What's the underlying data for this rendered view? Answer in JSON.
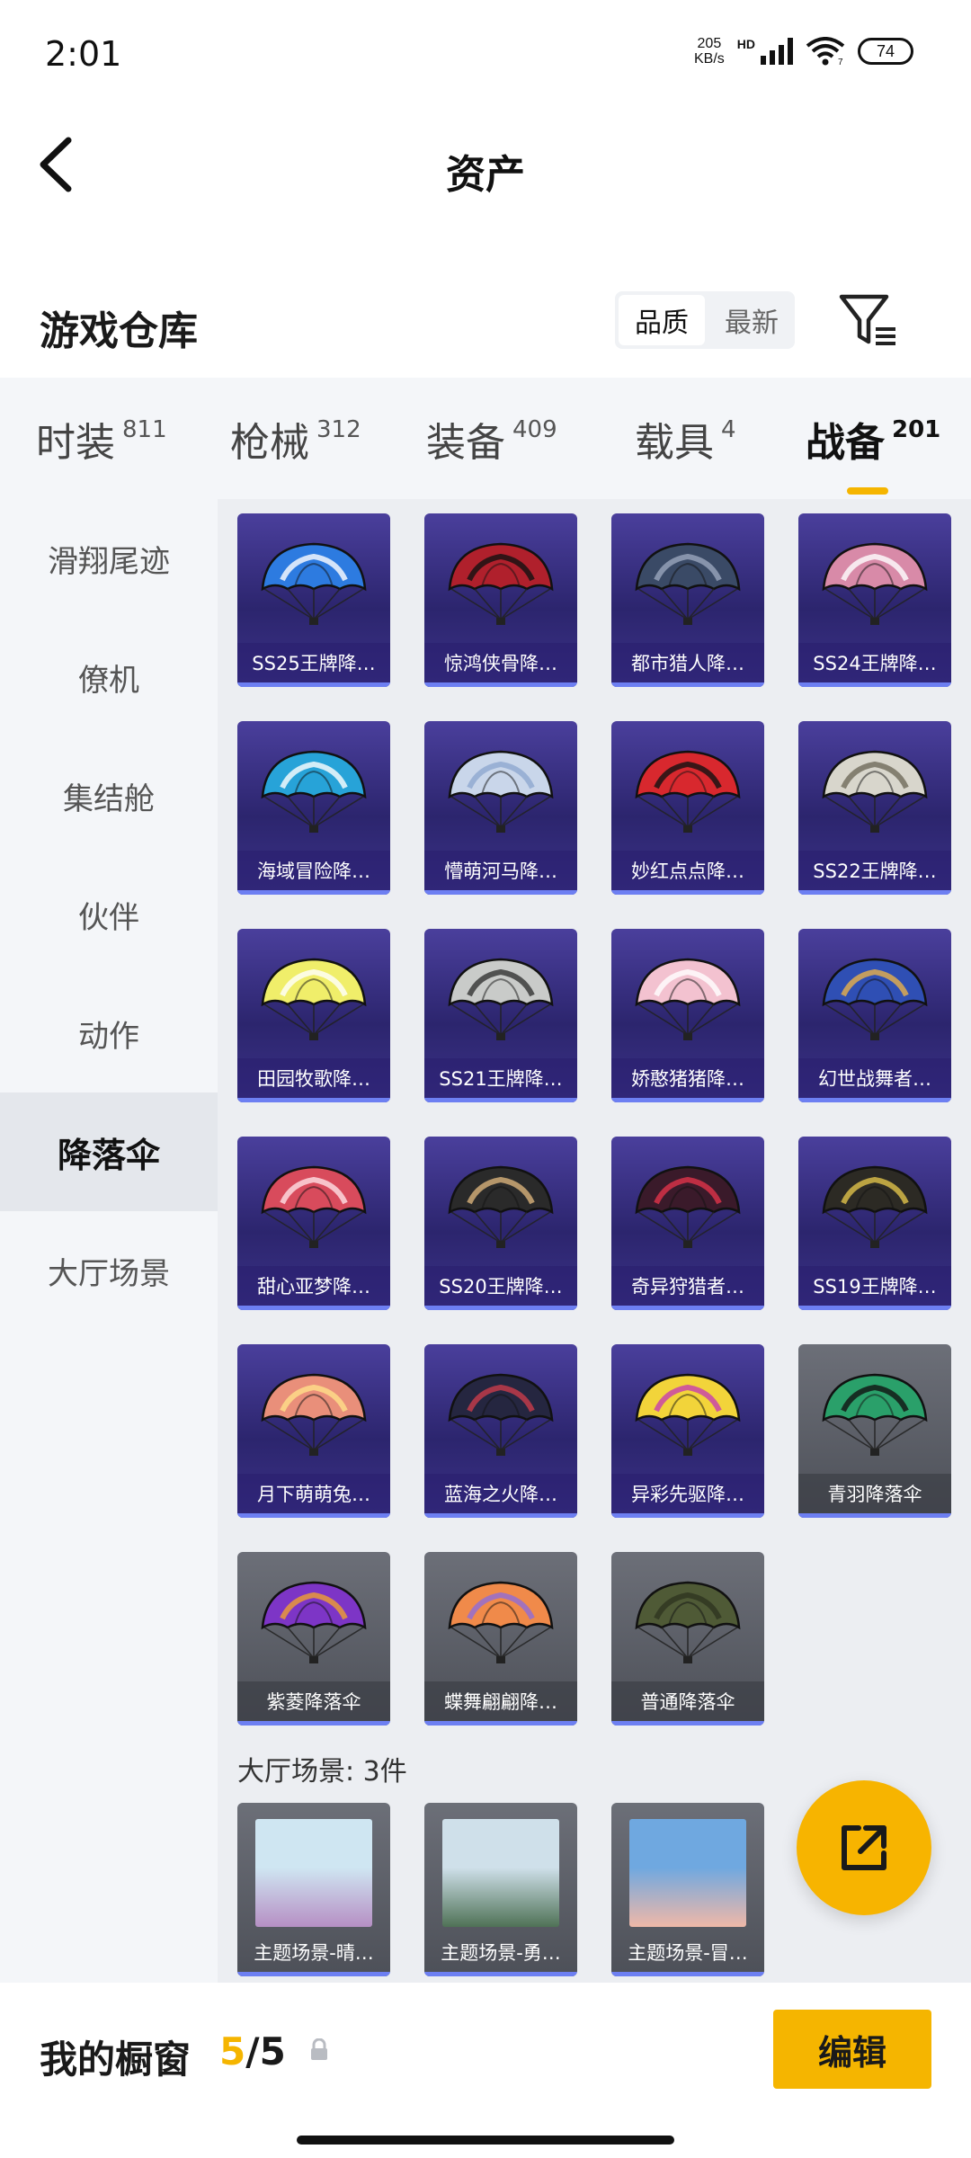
{
  "status": {
    "time": "2:01",
    "net_rate": "205",
    "net_unit": "KB/s",
    "hd": "HD",
    "wifi_sub": "7",
    "battery": "74"
  },
  "header": {
    "title": "资产",
    "back_icon": "back-chevron-icon"
  },
  "warehouse": {
    "title": "游戏仓库",
    "sort_quality": "品质",
    "sort_newest": "最新",
    "filter_icon": "filter-icon"
  },
  "tabs": [
    {
      "label": "时装",
      "count": "811",
      "active": false
    },
    {
      "label": "枪械",
      "count": "312",
      "active": false
    },
    {
      "label": "装备",
      "count": "409",
      "active": false
    },
    {
      "label": "载具",
      "count": "4",
      "active": false
    },
    {
      "label": "战备",
      "count": "201",
      "active": true
    }
  ],
  "subnav": [
    {
      "label": "滑翔尾迹",
      "active": false
    },
    {
      "label": "僚机",
      "active": false
    },
    {
      "label": "集结舱",
      "active": false
    },
    {
      "label": "伙伴",
      "active": false
    },
    {
      "label": "动作",
      "active": false
    },
    {
      "label": "降落伞",
      "active": true
    },
    {
      "label": "大厅场景",
      "active": false
    }
  ],
  "items": [
    {
      "name": "SS25王牌降…",
      "rarity": "legendary",
      "color": "#2d7be0",
      "accent": "#ffffff"
    },
    {
      "name": "惊鸿侠骨降…",
      "rarity": "legendary",
      "color": "#b0202c",
      "accent": "#111111"
    },
    {
      "name": "都市猎人降…",
      "rarity": "legendary",
      "color": "#3a4a66",
      "accent": "#9aa5bd"
    },
    {
      "name": "SS24王牌降…",
      "rarity": "legendary",
      "color": "#d88aa8",
      "accent": "#ffffff"
    },
    {
      "name": "海域冒险降…",
      "rarity": "legendary",
      "color": "#27a3d8",
      "accent": "#ffffff"
    },
    {
      "name": "懵萌河马降…",
      "rarity": "legendary",
      "color": "#c9d6ea",
      "accent": "#8fa7cf"
    },
    {
      "name": "妙红点点降…",
      "rarity": "legendary",
      "color": "#d8282e",
      "accent": "#111111"
    },
    {
      "name": "SS22王牌降…",
      "rarity": "legendary",
      "color": "#d8d6cc",
      "accent": "#6f6a5a"
    },
    {
      "name": "田园牧歌降…",
      "rarity": "legendary",
      "color": "#f0ee6a",
      "accent": "#ffffff"
    },
    {
      "name": "SS21王牌降…",
      "rarity": "legendary",
      "color": "#c9cbc9",
      "accent": "#333333"
    },
    {
      "name": "娇憨猪猪降…",
      "rarity": "legendary",
      "color": "#f3c2d0",
      "accent": "#ffffff"
    },
    {
      "name": "幻世战舞者…",
      "rarity": "legendary",
      "color": "#2f4fb4",
      "accent": "#e8b04a"
    },
    {
      "name": "甜心亚梦降…",
      "rarity": "legendary",
      "color": "#d84b5c",
      "accent": "#ffe1e6"
    },
    {
      "name": "SS20王牌降…",
      "rarity": "legendary",
      "color": "#2a2a2a",
      "accent": "#d8b27a"
    },
    {
      "name": "奇异狩猎者…",
      "rarity": "legendary",
      "color": "#3a1a2a",
      "accent": "#e0334a"
    },
    {
      "name": "SS19王牌降…",
      "rarity": "legendary",
      "color": "#2c2a24",
      "accent": "#e0c24a"
    },
    {
      "name": "月下萌萌兔…",
      "rarity": "legendary",
      "color": "#e98f7a",
      "accent": "#ffe08a"
    },
    {
      "name": "蓝海之火降…",
      "rarity": "legendary",
      "color": "#252640",
      "accent": "#c93c4a"
    },
    {
      "name": "异彩先驱降…",
      "rarity": "legendary",
      "color": "#f2d43a",
      "accent": "#c63cb0"
    },
    {
      "name": "青羽降落伞",
      "rarity": "common",
      "color": "#2aa06a",
      "accent": "#111111"
    },
    {
      "name": "紫菱降落伞",
      "rarity": "common",
      "color": "#7d35c6",
      "accent": "#f0a030"
    },
    {
      "name": "蝶舞翩翩降…",
      "rarity": "common",
      "color": "#f08a4a",
      "accent": "#8f6cd8"
    },
    {
      "name": "普通降落伞",
      "rarity": "common",
      "color": "#4f5a36",
      "accent": "#2e3520"
    }
  ],
  "scenes_section": {
    "title": "大厅场景: 3件"
  },
  "scenes": [
    {
      "name": "主题场景-晴…",
      "sky": "#cfe6f2",
      "ground": "#b68fc4"
    },
    {
      "name": "主题场景-勇…",
      "sky": "#cfe0ea",
      "ground": "#4f7256"
    },
    {
      "name": "主题场景-冒…",
      "sky": "#6fa8e0",
      "ground": "#f0b8a8"
    }
  ],
  "fab": {
    "icon": "share-out-icon"
  },
  "bottom": {
    "showcase_label": "我的橱窗",
    "count_used": "5",
    "count_sep": "/",
    "count_total": "5",
    "lock_icon": "lock-icon",
    "edit_label": "编辑"
  }
}
